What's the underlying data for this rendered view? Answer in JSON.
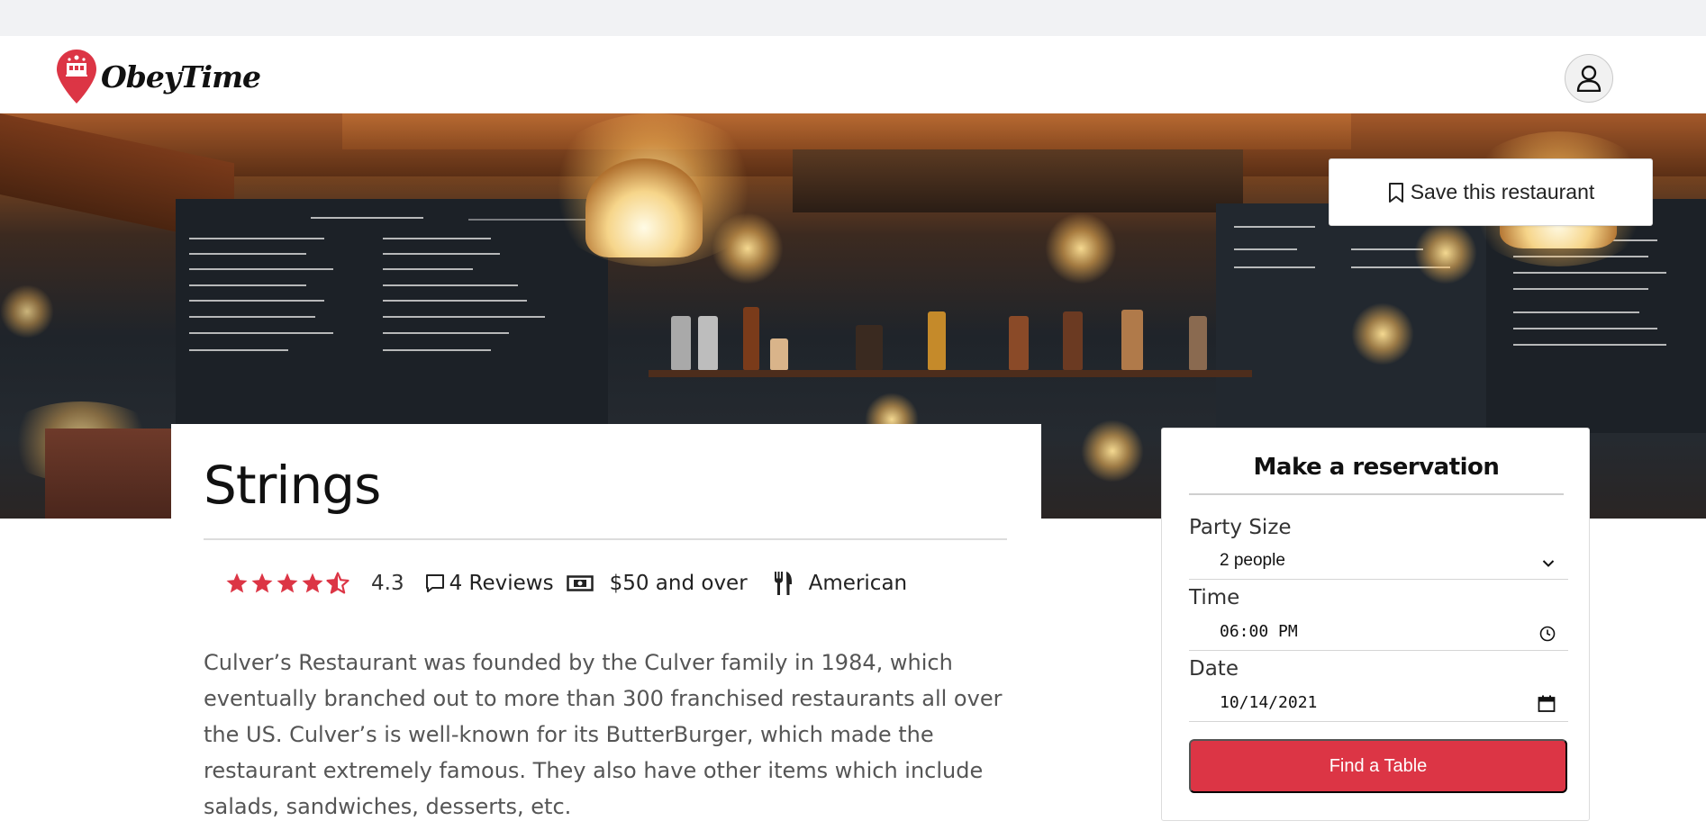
{
  "nav": {
    "brand": "ObeyTime",
    "brand_color": "#dc3545",
    "user_icon": "person-icon"
  },
  "hero": {
    "save_label": "Save this restaurant",
    "save_icon": "bookmark-icon"
  },
  "restaurant": {
    "name": "Strings",
    "rating": "4.3",
    "rating_value": 4.3,
    "rating_max": 5,
    "reviews": "4 Reviews",
    "price": "$50 and over",
    "cuisine": "American",
    "description": "Culver’s Restaurant was founded by the Culver family in 1984, which eventually branched out to more than 300 franchised restaurants all over the US. Culver’s is well-known for its ButterBurger, which made the restaurant extremely famous. They also have other items which include salads, sandwiches, desserts, etc."
  },
  "reservation": {
    "title": "Make a reservation",
    "party_size_label": "Party Size",
    "party_size_value": "2 people",
    "time_label": "Time",
    "time_value": "06:00 PM",
    "date_label": "Date",
    "date_value": "10/14/2021",
    "find_button": "Find a Table",
    "button_color": "#dc3545"
  }
}
